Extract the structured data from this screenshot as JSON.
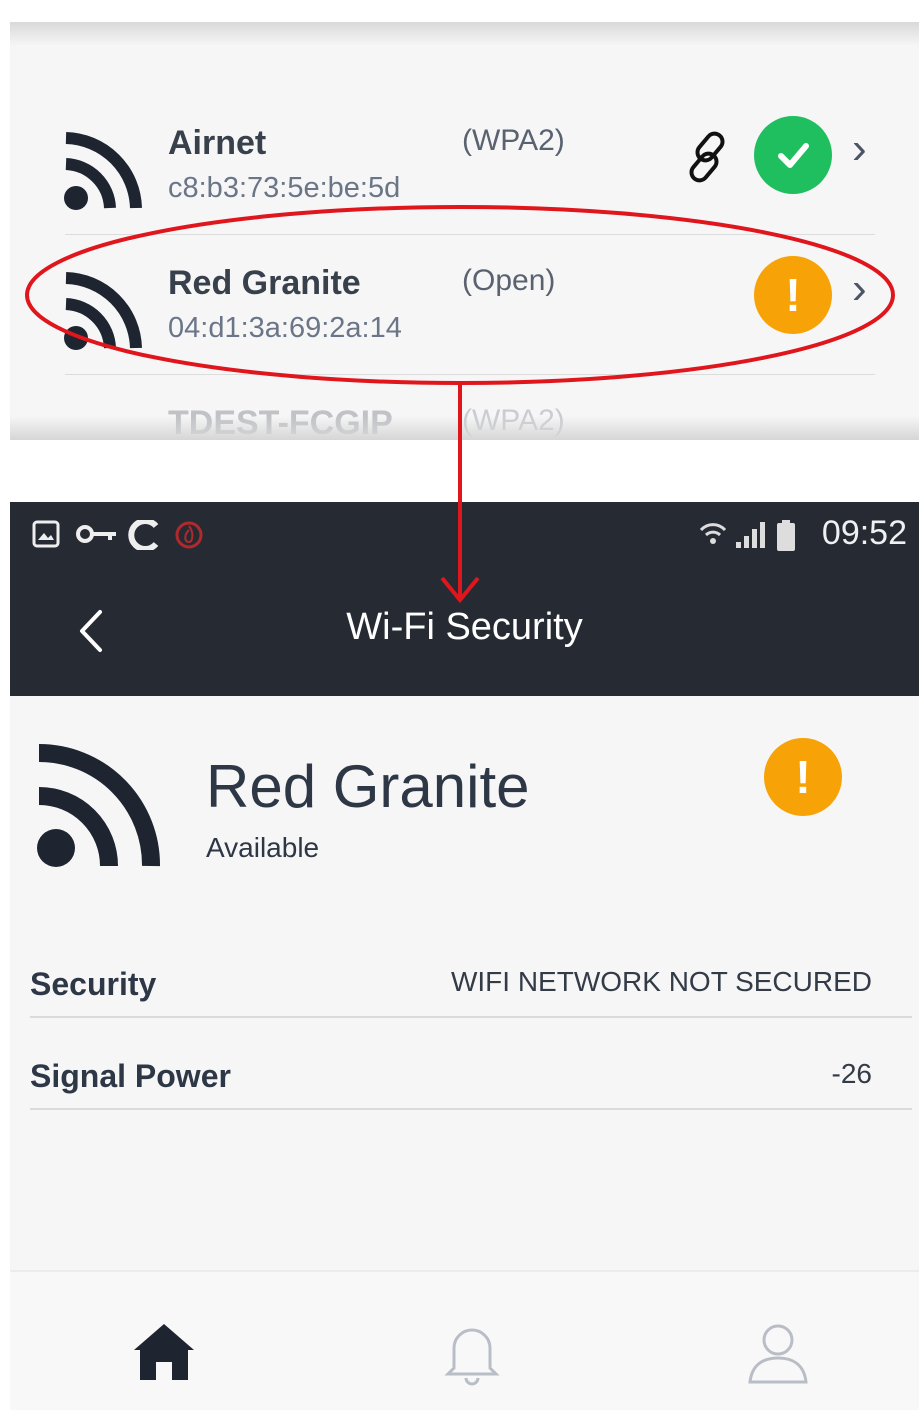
{
  "network_list": [
    {
      "name": "Airnet",
      "mac": "c8:b3:73:5e:be:5d",
      "encryption": "(WPA2)",
      "status": "secured"
    },
    {
      "name": "Red Granite",
      "mac": "04:d1:3a:69:2a:14",
      "encryption": "(Open)",
      "status": "warning"
    },
    {
      "name": "TDEST-FCGIP",
      "encryption": "(WPA2)"
    }
  ],
  "status_bar": {
    "time": "09:52"
  },
  "app_bar": {
    "title": "Wi-Fi Security"
  },
  "detail": {
    "network_name": "Red Granite",
    "availability": "Available",
    "badge_symbol": "!",
    "rows": [
      {
        "label": "Security",
        "value": "WIFI NETWORK NOT SECURED"
      },
      {
        "label": "Signal Power",
        "value": "-26"
      }
    ]
  },
  "icons": {
    "wifi": "wifi-icon",
    "ok": "check-circle-icon",
    "warning": "exclamation-circle-icon",
    "link": "link-icon",
    "chevron": "chevron-right-icon",
    "back": "back-arrow-icon",
    "home": "home-icon",
    "notifications": "bell-icon",
    "profile": "user-icon"
  },
  "colors": {
    "ok": "#1fbf60",
    "warning": "#f7a308",
    "header": "#262b33",
    "annotation": "#e0161d"
  }
}
